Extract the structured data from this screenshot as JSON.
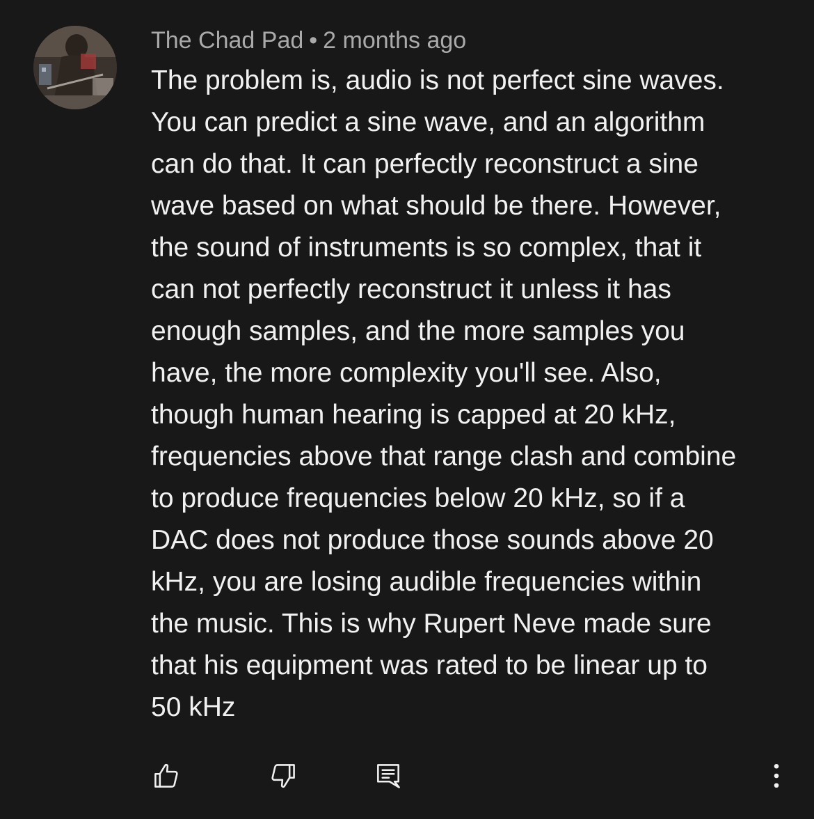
{
  "comment": {
    "author": "The Chad Pad",
    "separator": "•",
    "timestamp": "2 months ago",
    "body_lines": [
      "The problem is, audio is not perfect sine waves.",
      "You can predict a sine wave, and an algorithm",
      "can do that. It can perfectly reconstruct a sine",
      "wave based on what should be there. However,",
      "the sound of instruments is so complex, that it",
      "can not perfectly reconstruct it unless it has",
      "enough samples, and the more samples you",
      "have, the more complexity you'll see. Also,",
      "though human hearing is capped at 20 kHz,",
      "frequencies above that range clash and combine",
      "to produce frequencies below 20 kHz, so if a",
      "DAC does not produce those sounds above 20",
      "kHz, you are losing audible frequencies within",
      "the music. This is why Rupert Neve made sure",
      "that his equipment was rated to be linear up to",
      "50 kHz"
    ]
  },
  "actions": {
    "like_icon": "thumbs-up-icon",
    "dislike_icon": "thumbs-down-icon",
    "reply_icon": "comment-reply-icon",
    "more_icon": "more-vertical-icon"
  },
  "colors": {
    "background": "#181818",
    "text": "#f1f1f1",
    "meta": "#aaaaaa",
    "icon": "#f1f1f1"
  }
}
